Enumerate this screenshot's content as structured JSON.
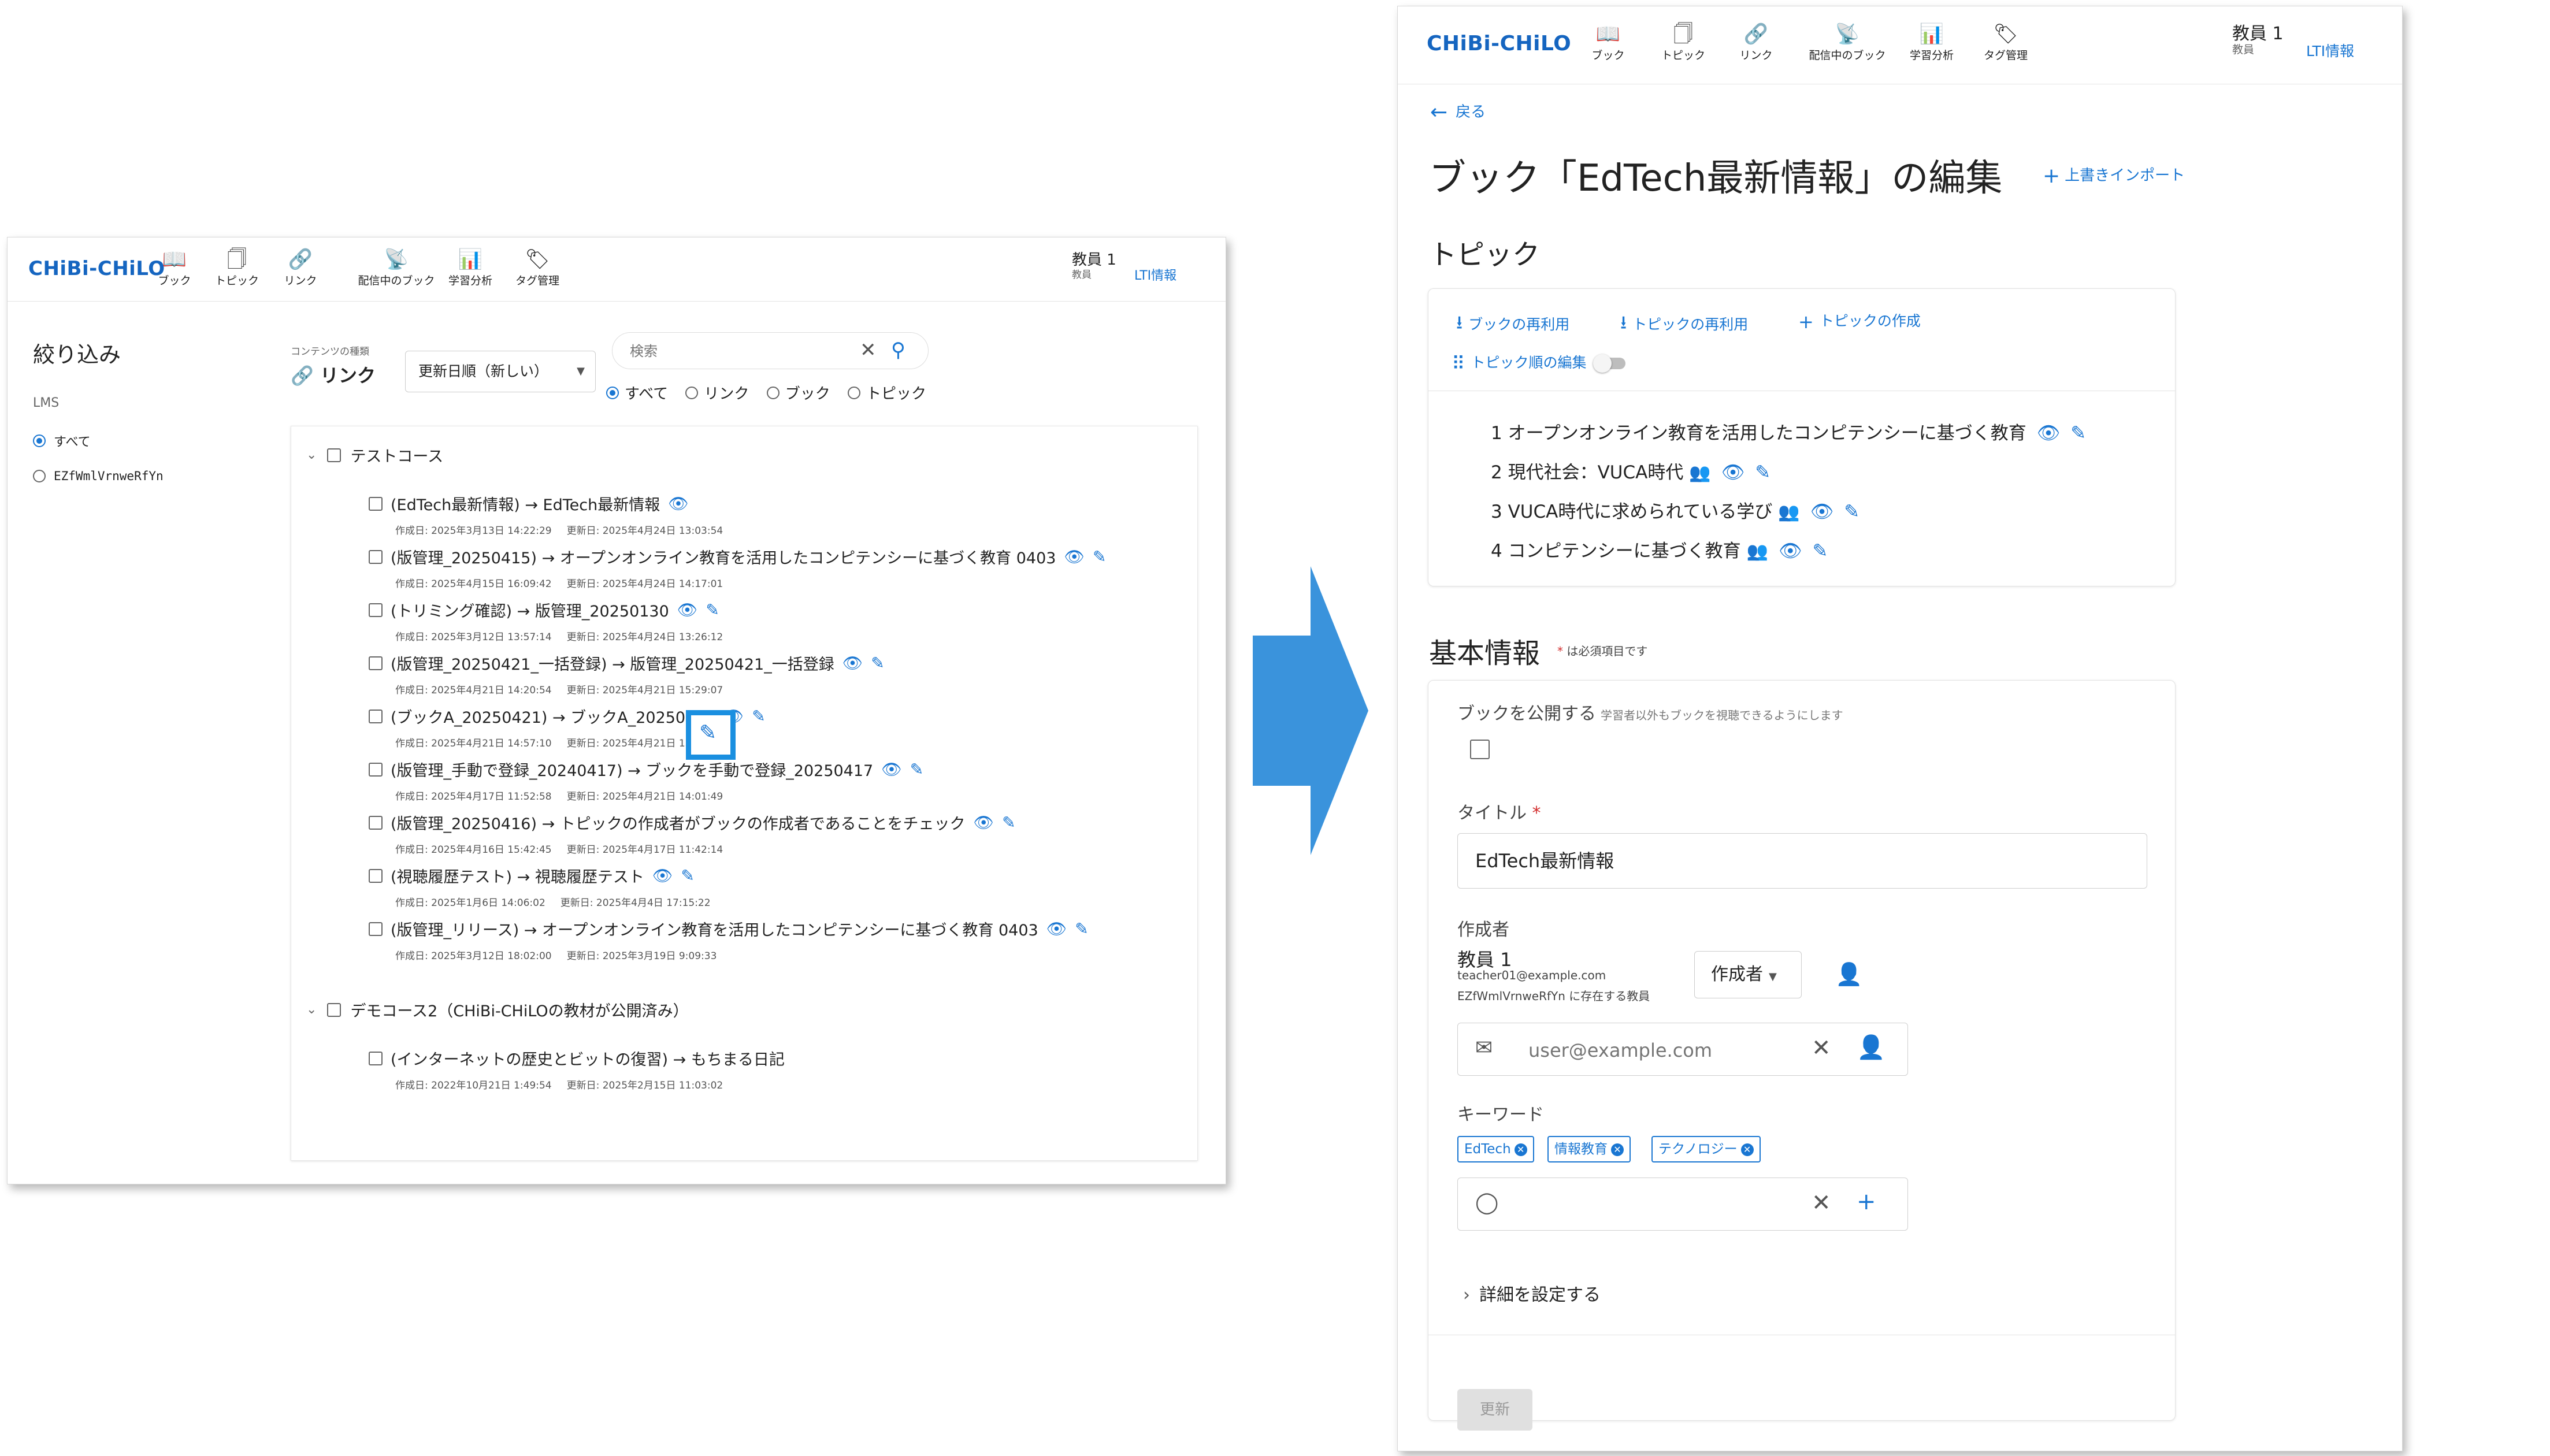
{
  "header": {
    "logo": "CHiBi-CHiLO",
    "nav": [
      {
        "label": "ブック",
        "icon": "book-icon"
      },
      {
        "label": "トピック",
        "icon": "topic-icon"
      },
      {
        "label": "リンク",
        "icon": "link-icon"
      },
      {
        "label": "配信中のブック",
        "icon": "broadcast-icon"
      },
      {
        "label": "学習分析",
        "icon": "analytics-icon"
      },
      {
        "label": "タグ管理",
        "icon": "tag-icon"
      }
    ],
    "user_name": "教員 1",
    "user_role": "教員",
    "lti_label": "LTI情報"
  },
  "list_view": {
    "filter_title": "絞り込み",
    "lms_label": "LMS",
    "lms_options": [
      "すべて",
      "EZfWmlVrnweRfYn"
    ],
    "content_type_label": "コンテンツの種類",
    "content_type_value": "リンク",
    "sort_value": "更新日順（新しい）",
    "search_placeholder": "検索",
    "type_options": [
      "すべて",
      "リンク",
      "ブック",
      "トピック"
    ],
    "courses": [
      {
        "name": "テストコース",
        "items": [
          {
            "title": "(EdTech最新情報) → EdTech最新情報",
            "created": "作成日: 2025年3月13日 14:22:29",
            "updated": "更新日: 2025年4月24日 13:03:54"
          },
          {
            "title": "(版管理_20250415) → オープンオンライン教育を活用したコンピテンシーに基づく教育 0403",
            "created": "作成日: 2025年4月15日 16:09:42",
            "updated": "更新日: 2025年4月24日 14:17:01"
          },
          {
            "title": "(トリミング確認) → 版管理_20250130",
            "created": "作成日: 2025年3月12日 13:57:14",
            "updated": "更新日: 2025年4月24日 13:26:12"
          },
          {
            "title": "(版管理_20250421_一括登録) → 版管理_20250421_一括登録",
            "created": "作成日: 2025年4月21日 14:20:54",
            "updated": "更新日: 2025年4月21日 15:29:07"
          },
          {
            "title": "(ブックA_20250421) → ブックA_20250421",
            "created": "作成日: 2025年4月21日 14:57:10",
            "updated": "更新日: 2025年4月21日 15:04:19"
          },
          {
            "title": "(版管理_手動で登録_20240417) → ブックを手動で登録_20250417",
            "created": "作成日: 2025年4月17日 11:52:58",
            "updated": "更新日: 2025年4月21日 14:01:49"
          },
          {
            "title": "(版管理_20250416) → トピックの作成者がブックの作成者であることをチェック",
            "created": "作成日: 2025年4月16日 15:42:45",
            "updated": "更新日: 2025年4月17日 11:42:14"
          },
          {
            "title": "(視聴履歴テスト) → 視聴履歴テスト",
            "created": "作成日: 2025年1月6日 14:06:02",
            "updated": "更新日: 2025年4月4日 17:15:22"
          },
          {
            "title": "(版管理_リリース) → オープンオンライン教育を活用したコンピテンシーに基づく教育 0403",
            "created": "作成日: 2025年3月12日 18:02:00",
            "updated": "更新日: 2025年3月19日 9:09:33"
          }
        ]
      },
      {
        "name": "デモコース2（CHiBi-CHiLOの教材が公開済み）",
        "items": [
          {
            "title": "(インターネットの歴史とビットの復習) → もちまる日記",
            "created": "作成日: 2022年10月21日 1:49:54",
            "updated": "更新日: 2025年2月15日 11:03:02"
          }
        ]
      }
    ]
  },
  "edit_view": {
    "back_label": "戻る",
    "page_title": "ブック「EdTech最新情報」の編集",
    "import_label": "上書きインポート",
    "topic_section_title": "トピック",
    "topic_actions": {
      "reuse_book": "ブックの再利用",
      "reuse_topic": "トピックの再利用",
      "create_topic": "トピックの作成",
      "reorder": "トピック順の編集"
    },
    "topics": [
      {
        "label": "1 オープンオンライン教育を活用したコンピテンシーに基づく教育",
        "shared": false
      },
      {
        "label": "2 現代社会：VUCA時代",
        "shared": true
      },
      {
        "label": "3 VUCA時代に求められている学び",
        "shared": true
      },
      {
        "label": "4 コンピテンシーに基づく教育",
        "shared": true
      }
    ],
    "basic_section_title": "基本情報",
    "required_note": "は必須項目です",
    "publish_label": "ブックを公開する",
    "publish_hint": "学習者以外もブックを視聴できるようにします",
    "title_label": "タイトル",
    "title_value": "EdTech最新情報",
    "author_label": "作成者",
    "author_name": "教員 1",
    "author_email": "teacher01@example.com",
    "author_org": "EZfWmlVrnweRfYn に存在する教員",
    "author_role": "作成者",
    "email_placeholder": "user@example.com",
    "keyword_label": "キーワード",
    "keywords": [
      "EdTech",
      "情報教育",
      "テクノロジー"
    ],
    "details_label": "詳細を設定する",
    "update_label": "更新"
  },
  "colors": {
    "accent": "#1976d2",
    "arrow": "#3a93dc",
    "highlight": "#1a8fe0",
    "required": "#d32f2f"
  }
}
